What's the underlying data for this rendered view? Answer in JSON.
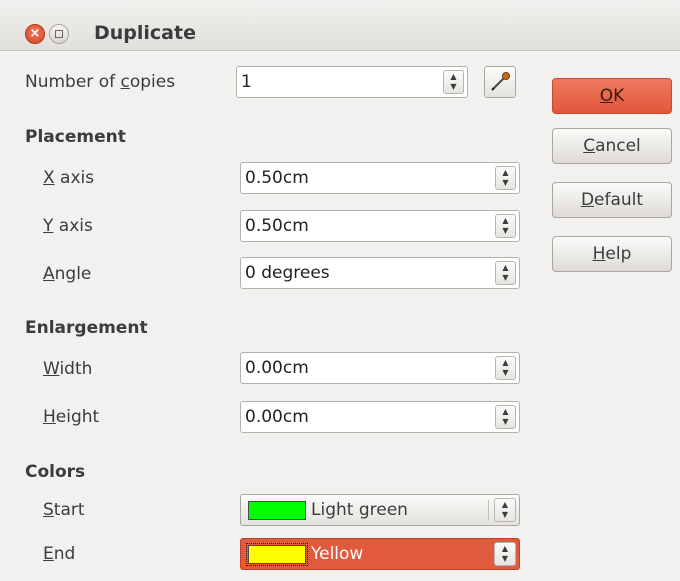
{
  "window": {
    "title": "Duplicate"
  },
  "copies": {
    "label_pre": "Number of ",
    "label_mn": "c",
    "label_post": "opies",
    "value": "1"
  },
  "placement": {
    "title": "Placement",
    "x_axis": {
      "mn": "X",
      "rest": " axis",
      "value": "0.50cm"
    },
    "y_axis": {
      "mn": "Y",
      "rest": " axis",
      "value": "0.50cm"
    },
    "angle": {
      "mn": "A",
      "rest": "ngle",
      "value": "0 degrees"
    }
  },
  "enlargement": {
    "title": "Enlargement",
    "width": {
      "mn": "W",
      "rest": "idth",
      "value": "0.00cm"
    },
    "height": {
      "mn": "H",
      "rest": "eight",
      "value": "0.00cm"
    }
  },
  "colors": {
    "title": "Colors",
    "start": {
      "mn": "S",
      "rest": "tart",
      "value": "Light green",
      "swatch": "#00ff00"
    },
    "end": {
      "mn": "E",
      "rest": "nd",
      "value": "Yellow",
      "swatch": "#ffff00"
    }
  },
  "buttons": {
    "ok": {
      "mn": "O",
      "rest": "K"
    },
    "cancel": {
      "mn": "C",
      "rest": "ancel"
    },
    "default": {
      "mn": "D",
      "rest": "efault"
    },
    "help": {
      "mn": "H",
      "rest": "elp"
    }
  },
  "icons": {
    "close": "close-icon",
    "minimize": "minimize-icon",
    "pipette": "pipette-icon",
    "spin": "spin-arrows-icon"
  },
  "theme": {
    "accent": "#e0573b"
  }
}
